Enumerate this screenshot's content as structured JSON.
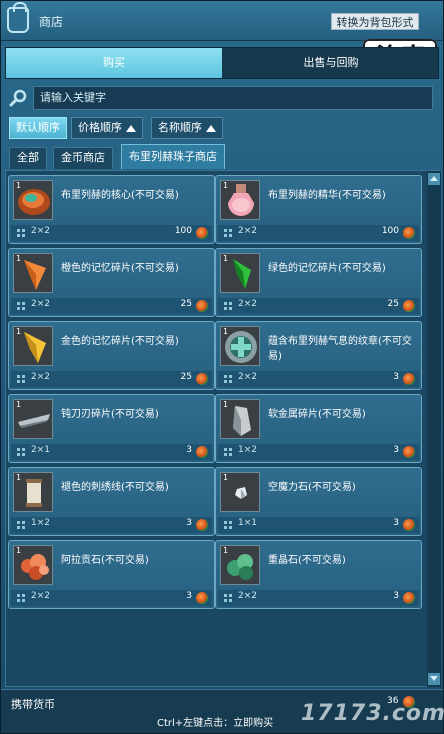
{
  "window": {
    "title": "商店",
    "convert_button": "转换为背包形式"
  },
  "logo_text": "洛奇",
  "tabs": {
    "buy": "购买",
    "sell": "出售与回购"
  },
  "search": {
    "placeholder": "请输入关键字"
  },
  "sort": {
    "default": "默认顺序",
    "price": "价格顺序",
    "name": "名称顺序"
  },
  "filters": [
    "全部",
    "金币商店",
    "布里列赫珠子商店"
  ],
  "items": [
    {
      "slot_count": "1",
      "name": "布里列赫的核心(不可交易)",
      "size": "2×2",
      "price": "100",
      "icon": "orange-core-icon"
    },
    {
      "slot_count": "1",
      "name": "布里列赫的精华(不可交易)",
      "size": "2×2",
      "price": "100",
      "icon": "pink-potion-icon"
    },
    {
      "slot_count": "1",
      "name": "橙色的记忆碎片(不可交易)",
      "size": "2×2",
      "price": "25",
      "icon": "orange-shard-icon"
    },
    {
      "slot_count": "1",
      "name": "绿色的记忆碎片(不可交易)",
      "size": "2×2",
      "price": "25",
      "icon": "green-shard-icon"
    },
    {
      "slot_count": "1",
      "name": "金色的记忆碎片(不可交易)",
      "size": "2×2",
      "price": "25",
      "icon": "gold-shard-icon"
    },
    {
      "slot_count": "1",
      "name": "蕴含布里列赫气息的纹章(不可交易)",
      "size": "2×2",
      "price": "3",
      "icon": "emblem-icon"
    },
    {
      "slot_count": "1",
      "name": "钝刀刃碎片(不可交易)",
      "size": "2×1",
      "price": "3",
      "icon": "blade-fragment-icon"
    },
    {
      "slot_count": "1",
      "name": "软金属碎片(不可交易)",
      "size": "1×2",
      "price": "3",
      "icon": "metal-fragment-icon"
    },
    {
      "slot_count": "1",
      "name": "褪色的刺绣线(不可交易)",
      "size": "1×2",
      "price": "3",
      "icon": "thread-spool-icon"
    },
    {
      "slot_count": "1",
      "name": "空魔力石(不可交易)",
      "size": "1×1",
      "price": "3",
      "icon": "mana-stone-icon"
    },
    {
      "slot_count": "1",
      "name": "阿拉贡石(不可交易)",
      "size": "2×2",
      "price": "3",
      "icon": "aragonite-icon"
    },
    {
      "slot_count": "1",
      "name": "重晶石(不可交易)",
      "size": "2×2",
      "price": "3",
      "icon": "barite-icon"
    }
  ],
  "footer": {
    "currency_label": "携带货币",
    "currency_value": "36",
    "hint": "Ctrl+左键点击：立即购买"
  },
  "watermark": "17173.com"
}
